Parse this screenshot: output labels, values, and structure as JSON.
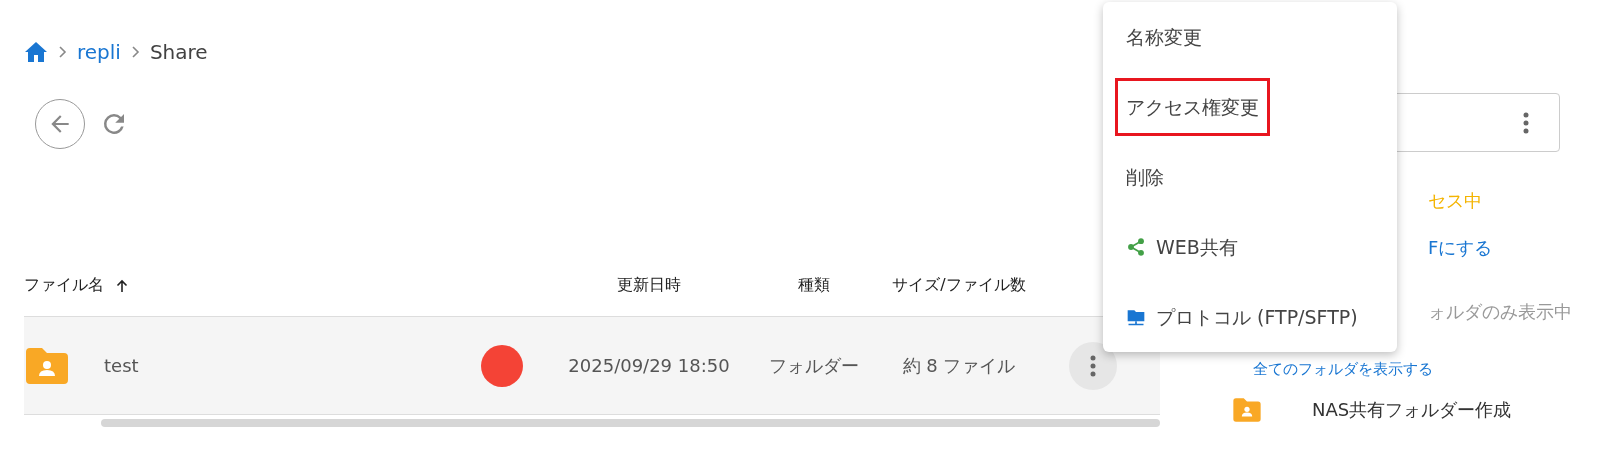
{
  "breadcrumb": [
    {
      "kind": "home"
    },
    {
      "kind": "link",
      "label": "repli"
    },
    {
      "kind": "current",
      "label": "Share"
    }
  ],
  "table": {
    "columns": [
      {
        "label": "ファイル名",
        "sorted": true
      },
      {},
      {
        "label": "更新日時"
      },
      {
        "label": "種類"
      },
      {
        "label": "サイズ/ファイル数"
      }
    ],
    "rows": [
      {
        "name": "test",
        "color": "#f44336",
        "modified": "2025/09/29 18:50",
        "type": "フォルダー",
        "size": "約 8 ファイル"
      }
    ]
  },
  "side_panel": {
    "status_text": "セス中",
    "toggle_link": "Fにする",
    "filter_text": "ォルダのみ表示中",
    "show_all_link": "全てのフォルダを表示する",
    "create_action": "NAS共有フォルダー作成"
  },
  "context_menu": [
    {
      "label": "名称変更",
      "outlined": false
    },
    {
      "label": "アクセス権変更",
      "outlined": true
    },
    {
      "label": "削除",
      "outlined": false
    },
    {
      "label": "WEB共有",
      "kind": "share",
      "outlined": false
    },
    {
      "label": "プロトコル (FTP/SFTP)",
      "kind": "network",
      "outlined": false
    }
  ]
}
